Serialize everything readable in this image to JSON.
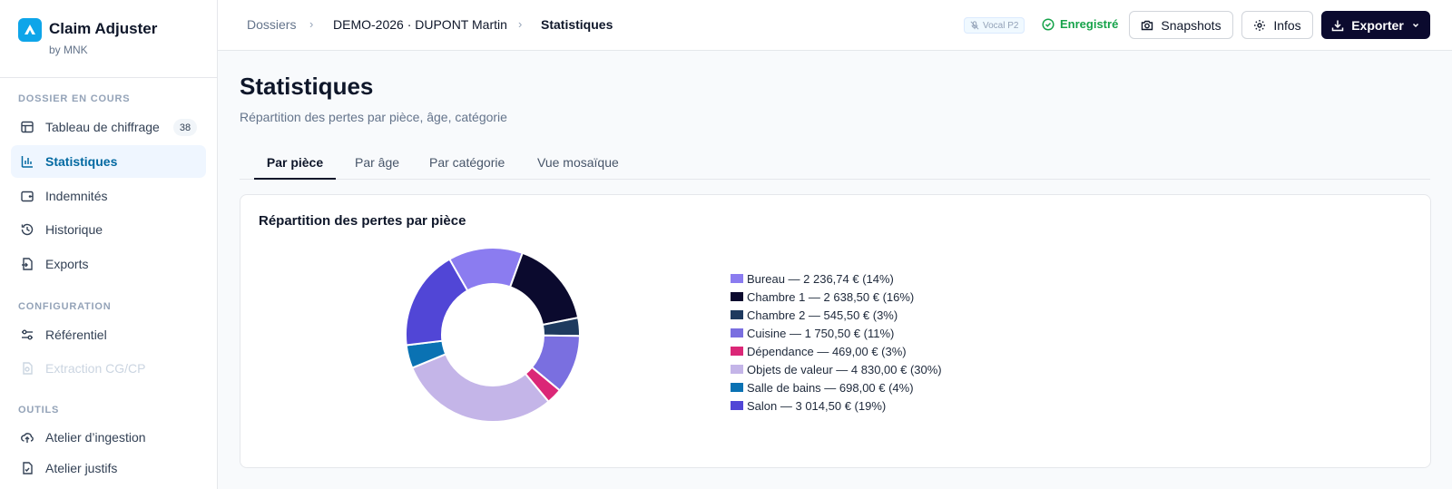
{
  "brand": {
    "title": "Claim Adjuster",
    "sub": "by MNK"
  },
  "sidebar": {
    "sections": [
      {
        "label": "DOSSIER EN COURS"
      },
      {
        "label": "CONFIGURATION"
      },
      {
        "label": "OUTILS"
      }
    ],
    "items": [
      {
        "label": "Tableau de chiffrage",
        "badge": "38"
      },
      {
        "label": "Statistiques"
      },
      {
        "label": "Indemnités"
      },
      {
        "label": "Historique"
      },
      {
        "label": "Exports"
      },
      {
        "label": "Référentiel"
      },
      {
        "label": "Extraction CG/CP"
      },
      {
        "label": "Atelier d’ingestion"
      },
      {
        "label": "Atelier justifs"
      }
    ]
  },
  "breadcrumb": {
    "root": "Dossiers",
    "dossier": "DEMO-2026 · DUPONT Martin",
    "current": "Statistiques"
  },
  "topbar": {
    "vocal": "Vocal P2",
    "status": "Enregistré",
    "snapshots": "Snapshots",
    "infos": "Infos",
    "export": "Exporter"
  },
  "page": {
    "title": "Statistiques",
    "subtitle": "Répartition des pertes par pièce, âge, catégorie"
  },
  "tabs": [
    {
      "label": "Par pièce"
    },
    {
      "label": "Par âge"
    },
    {
      "label": "Par catégorie"
    },
    {
      "label": "Vue mosaïque"
    }
  ],
  "chart_data": {
    "type": "pie",
    "donut": true,
    "title": "Répartition des pertes par pièce",
    "legend_position": "right",
    "slices": [
      {
        "label": "Bureau — 2 236,74 € (14%)",
        "name": "Bureau",
        "value": 2236.74,
        "color": "#8b7cf0"
      },
      {
        "label": "Chambre 1 — 2 638,50 € (16%)",
        "name": "Chambre 1",
        "value": 2638.5,
        "color": "#0b0a2e"
      },
      {
        "label": "Chambre 2 — 545,50 € (3%)",
        "name": "Chambre 2",
        "value": 545.5,
        "color": "#1e3a5f"
      },
      {
        "label": "Cuisine — 1 750,50 € (11%)",
        "name": "Cuisine",
        "value": 1750.5,
        "color": "#7a6fe0"
      },
      {
        "label": "Dépendance — 469,00 € (3%)",
        "name": "Dépendance",
        "value": 469.0,
        "color": "#db2777"
      },
      {
        "label": "Objets de valeur — 4 830,00 € (30%)",
        "name": "Objets de valeur",
        "value": 4830.0,
        "color": "#c4b5e8"
      },
      {
        "label": "Salle de bains — 698,00 € (4%)",
        "name": "Salle de bains",
        "value": 698.0,
        "color": "#0a72b3"
      },
      {
        "label": "Salon — 3 014,50 € (19%)",
        "name": "Salon",
        "value": 3014.5,
        "color": "#5146d6"
      }
    ]
  }
}
